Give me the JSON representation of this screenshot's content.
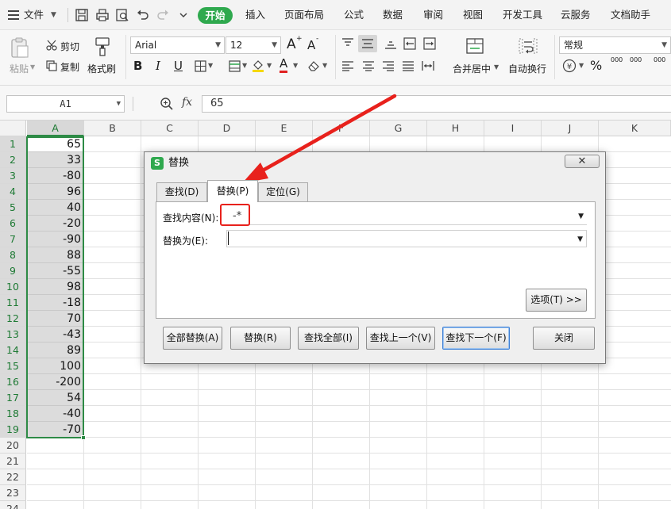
{
  "menu": {
    "file": "文件",
    "tabs": [
      "开始",
      "插入",
      "页面布局",
      "公式",
      "数据",
      "审阅",
      "视图",
      "开发工具",
      "云服务",
      "文档助手"
    ],
    "quick_icons": [
      "save-icon",
      "print-icon",
      "print-preview-icon",
      "undo-icon",
      "redo-icon",
      "more-icon"
    ]
  },
  "ribbon": {
    "paste": "粘贴",
    "cut": "剪切",
    "copy": "复制",
    "format_painter": "格式刷",
    "font_name": "Arial",
    "font_size": "12",
    "bold": "B",
    "italic": "I",
    "underline": "U",
    "merge_center": "合并居中",
    "wrap_text": "自动换行",
    "number_format": "常规",
    "percent": "%",
    "comma": "000",
    "grow_font": "A",
    "shrink_font": "A",
    "font_color_letter": "A",
    "thousand_sep": "000"
  },
  "formula_bar": {
    "cell_ref": "A1",
    "fx": "fx",
    "value": "65"
  },
  "grid": {
    "columns": [
      "A",
      "B",
      "C",
      "D",
      "E",
      "F",
      "G",
      "H",
      "I",
      "J",
      "K"
    ],
    "rows": [
      "1",
      "2",
      "3",
      "4",
      "5",
      "6",
      "7",
      "8",
      "9",
      "10",
      "11",
      "12",
      "13",
      "14",
      "15",
      "16",
      "17",
      "18",
      "19",
      "20",
      "21",
      "22",
      "23",
      "24"
    ],
    "column_a": [
      "65",
      "33",
      "-80",
      "96",
      "40",
      "-20",
      "-90",
      "88",
      "-55",
      "98",
      "-18",
      "70",
      "-43",
      "89",
      "100",
      "-200",
      "54",
      "-40",
      "-70"
    ]
  },
  "dialog": {
    "title": "替换",
    "logo": "S",
    "close": "✕",
    "tabs": [
      "查找(D)",
      "替换(P)",
      "定位(G)"
    ],
    "find_label": "查找内容(N):",
    "find_value": "-*",
    "replace_label": "替换为(E):",
    "replace_value": "",
    "options_button": "选项(T) >>",
    "buttons": [
      "全部替换(A)",
      "替换(R)",
      "查找全部(I)",
      "查找上一个(V)",
      "查找下一个(F)",
      "关闭"
    ]
  },
  "colors": {
    "accent_green": "#2fa94e",
    "selection_green": "#2e8b46",
    "annotation_red": "#e8211c"
  }
}
